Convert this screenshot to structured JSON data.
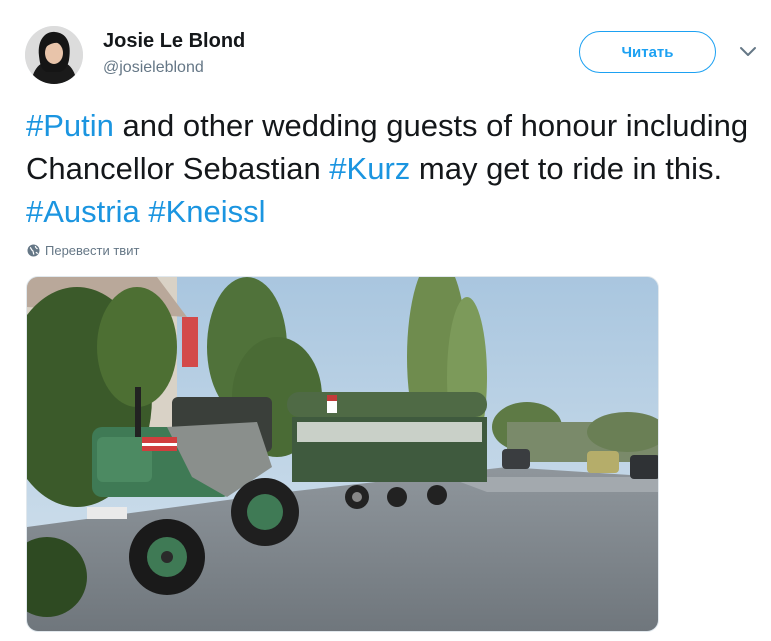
{
  "author": {
    "name": "Josie Le Blond",
    "handle": "@josieleblond",
    "avatar_icon": "profile-photo"
  },
  "follow_button": {
    "label": "Читать"
  },
  "menu": {
    "icon": "chevron-down-icon"
  },
  "tweet": {
    "segments": [
      {
        "text": "#Putin",
        "hashtag": true
      },
      {
        "text": " and other wedding guests of honour including Chancellor Sebastian ",
        "hashtag": false
      },
      {
        "text": "#Kurz",
        "hashtag": true
      },
      {
        "text": " may get to ride in this. ",
        "hashtag": false
      },
      {
        "text": "#Austria",
        "hashtag": true
      },
      {
        "text": " ",
        "hashtag": false
      },
      {
        "text": "#Kneissl",
        "hashtag": true
      }
    ]
  },
  "translate": {
    "label": "Перевести твит",
    "icon": "globe-icon"
  },
  "media": {
    "icon": "photo"
  },
  "colors": {
    "accent": "#1da1f2",
    "hashtag": "#1b95e0",
    "text": "#14171a",
    "secondary": "#657786"
  }
}
